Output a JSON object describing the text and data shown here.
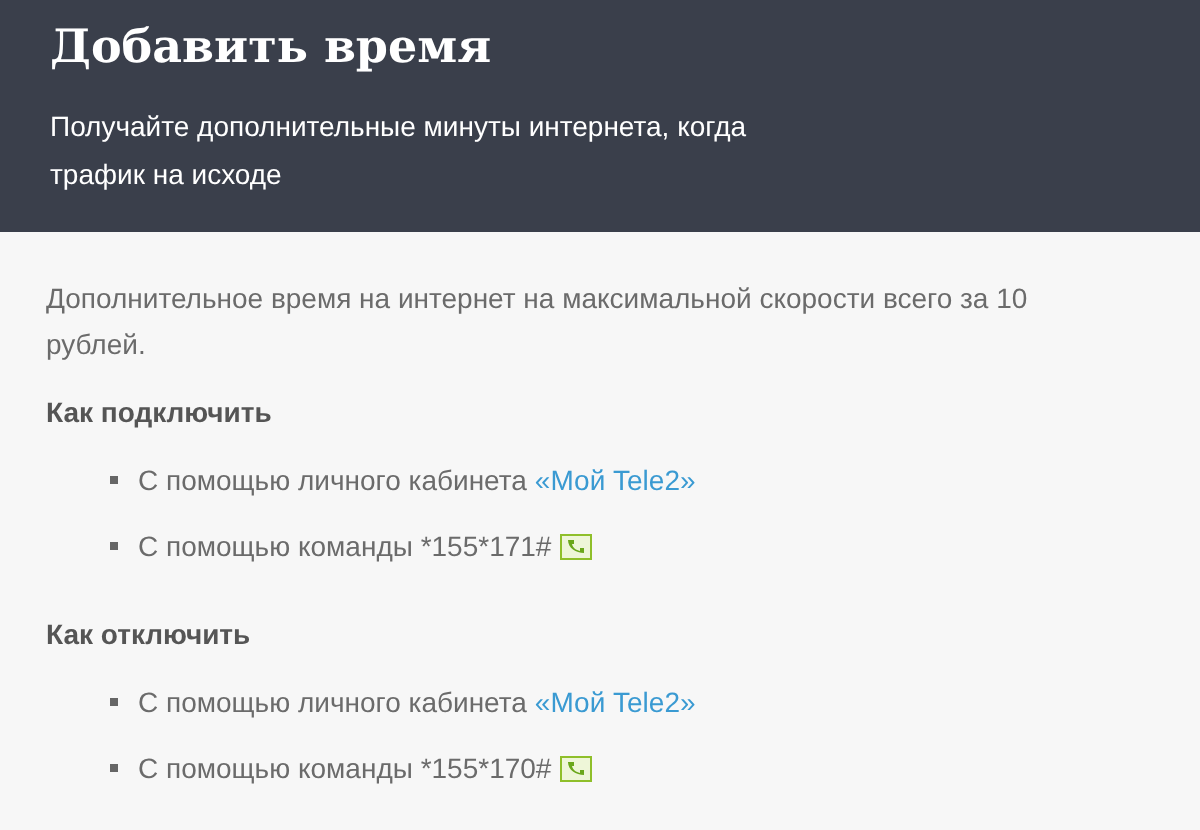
{
  "header": {
    "title": "Добавить время",
    "subtitle": "Получайте дополнительные минуты интернета, когда трафик на исходе"
  },
  "description": "Дополнительное время на  интернет на максимальной скорости всего за 10 рублей.",
  "sections": [
    {
      "heading": "Как подключить",
      "items": [
        {
          "kind": "link",
          "text": "С помощью личного кабинета",
          "link": "«Мой Tele2»"
        },
        {
          "kind": "command",
          "text": "С помощью команды *155*171#"
        }
      ]
    },
    {
      "heading": "Как отключить",
      "items": [
        {
          "kind": "link",
          "text": "С помощью личного кабинета",
          "link": "«Мой Tele2»"
        },
        {
          "kind": "command",
          "text": "С помощью команды *155*170#"
        }
      ]
    }
  ]
}
